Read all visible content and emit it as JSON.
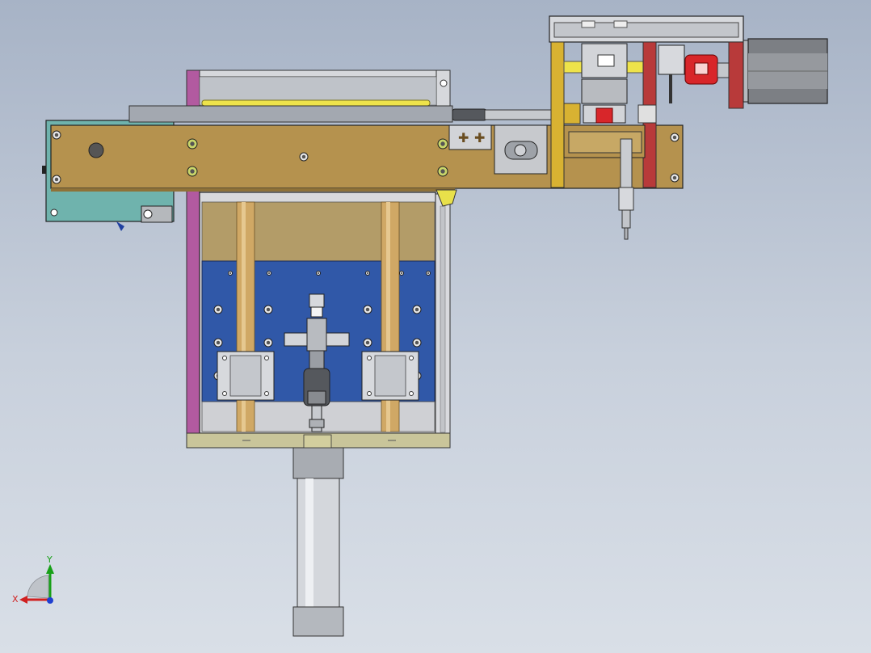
{
  "triad": {
    "x_label": "X",
    "y_label": "Y",
    "x_color": "#d02020",
    "y_color": "#18a018",
    "z_color": "#2040d0"
  },
  "palette": {
    "background_top": "#a7b3c6",
    "background_bottom": "#d9dfe7",
    "bronze_plate": "#b5924e",
    "teal_plate": "#6fb3ad",
    "magenta_rail": "#b25aa0",
    "blue_panel": "#3058a8",
    "red_bracket": "#b83a3a",
    "yellow_frame": "#d8b232",
    "steel": "#c8cbd0",
    "motor": "#7c7f84"
  },
  "components": [
    "main-bronze-plate",
    "left-teal-bracket",
    "box-housing",
    "blue-backplate",
    "guide-rod-left",
    "guide-rod-right",
    "linear-block-left",
    "linear-block-right",
    "center-actuator",
    "bottom-cylinder",
    "top-gantry-frame",
    "stepper-motor",
    "red-coupling",
    "vertical-pin"
  ]
}
